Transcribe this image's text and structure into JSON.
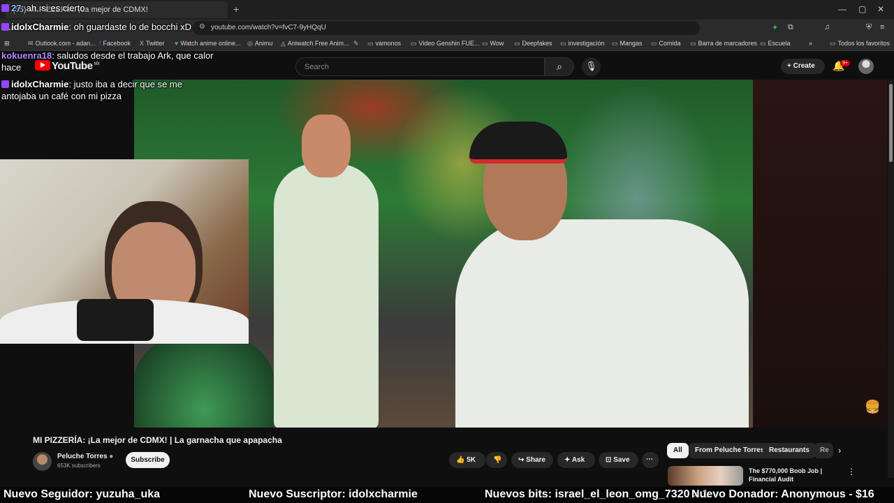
{
  "browser": {
    "tab_title": "(55) MI PIZZERÍA: ¡La mejor de CDMX!",
    "url": "youtube.com/watch?v=fvC7-9yHQqU",
    "bookmarks": [
      "Outlook.com - adan...",
      "Facebook",
      "Twitter",
      "Watch anime online...",
      "Animu",
      "Aniwatch Free Anim...",
      "vamonos",
      "Video Genshin FUE...",
      "Wow",
      "Deepfakes",
      "investigación",
      "Mangas",
      "Comida",
      "Barra de marcadores",
      "Escuela"
    ],
    "all_bookmarks": "Todos los favoritos"
  },
  "youtube": {
    "logo": "YouTube",
    "region": "MX",
    "search_placeholder": "Search",
    "create_label": "Create",
    "notification_count": "9+"
  },
  "chat": [
    {
      "user": "israel_el_leon_omg_7320",
      "message": "ah, si es cierto",
      "user_display": "27",
      "color": "#8ab4ff"
    },
    {
      "user": "idolxCharmie",
      "message": "oh guardaste lo de bocchi xD",
      "color": "#ffffff"
    },
    {
      "user": "kokuenra18",
      "message": "saludos desde el trabajo Ark, que calor hace",
      "color": "#b08aff"
    },
    {
      "user": "idolxCharmie",
      "message": "justo iba a decir que se me antojaba un café con mi pizza",
      "color": "#ffffff"
    }
  ],
  "video": {
    "title": "MI PIZZERÍA: ¡La mejor de CDMX! | La garnacha que apapacha",
    "channel": "Peluche Torres",
    "subscribers": "653K subscribers",
    "subscribe_label": "Subscribe",
    "likes": "5K",
    "share_label": "Share",
    "ask_label": "Ask",
    "save_label": "Save"
  },
  "chips": [
    "All",
    "From Peluche Torres",
    "Restaurants",
    "Re"
  ],
  "recommendation": {
    "title_line1": "The $770,000 Boob Job |",
    "title_line2": "Financial Audit"
  },
  "ticker": {
    "follower": "Nuevo Seguidor: yuzuha_uka",
    "subscriber": "Nuevo Suscriptor: idolxcharmie",
    "bits": "Nuevos bits: israel_el_leon_omg_7320 x 1",
    "donor": "Nuevo Donador: Anonymous - $16"
  },
  "colors": {
    "yt_red": "#ff0000",
    "subscribe_bg": "#f1f1f1",
    "chip_bg": "#272727"
  }
}
